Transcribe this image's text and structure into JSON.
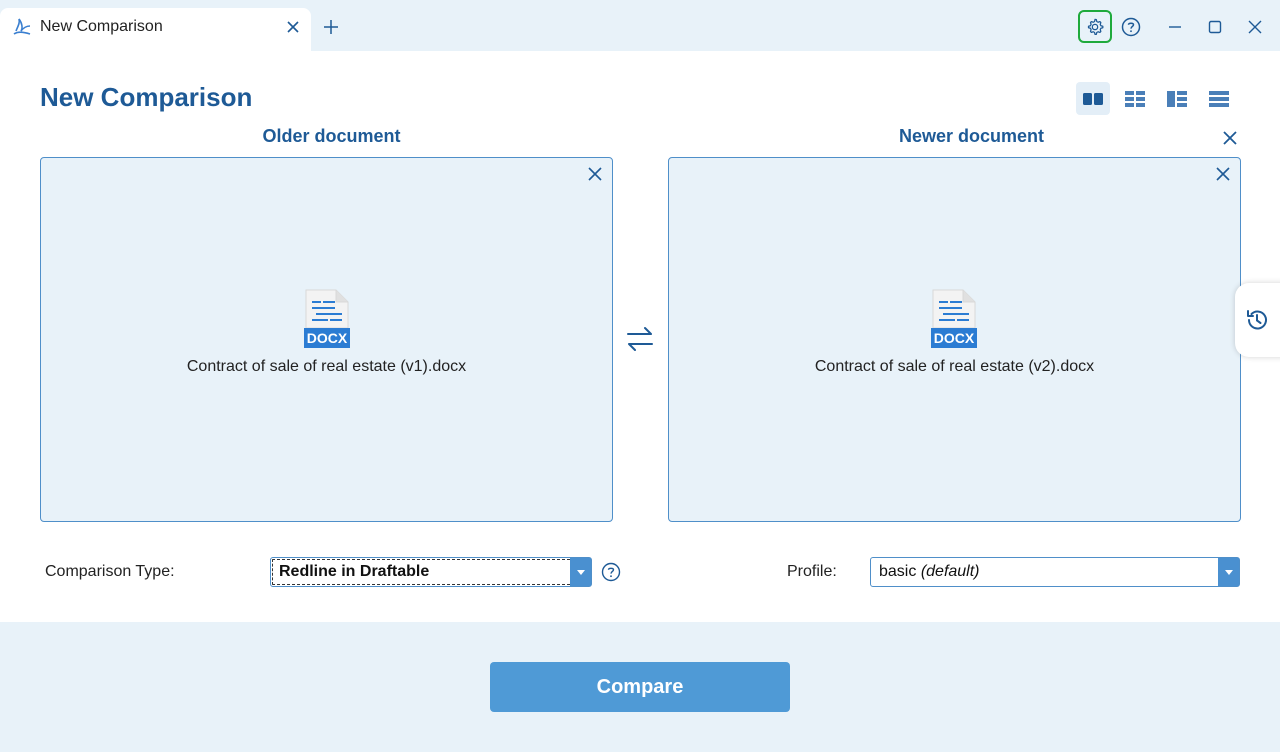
{
  "tab": {
    "title": "New Comparison"
  },
  "heading": {
    "title": "New Comparison"
  },
  "columns": {
    "older_label": "Older document",
    "newer_label": "Newer document"
  },
  "older_document": {
    "file_type": "DOCX",
    "file_name": "Contract of sale of real estate (v1).docx"
  },
  "newer_document": {
    "file_type": "DOCX",
    "file_name": "Contract of sale of real estate (v2).docx"
  },
  "comparison_type": {
    "label": "Comparison Type:",
    "selected": "Redline in Draftable"
  },
  "profile": {
    "label": "Profile:",
    "selected_name": "basic",
    "selected_suffix": "(default)"
  },
  "actions": {
    "compare_label": "Compare"
  },
  "icons": {
    "app_logo": "draftable-logo",
    "settings": "gear-icon",
    "help": "question-circle-icon",
    "swap": "swap-arrows-icon",
    "history": "history-icon",
    "layouts": [
      "side-by-side-layout-icon",
      "grid-layout-icon",
      "split-layout-icon",
      "stacked-layout-icon"
    ]
  },
  "colors": {
    "accent": "#1e5a96",
    "panel_bg": "#e8f2f9",
    "button": "#4f9ad6",
    "highlight": "#1faa3c"
  }
}
